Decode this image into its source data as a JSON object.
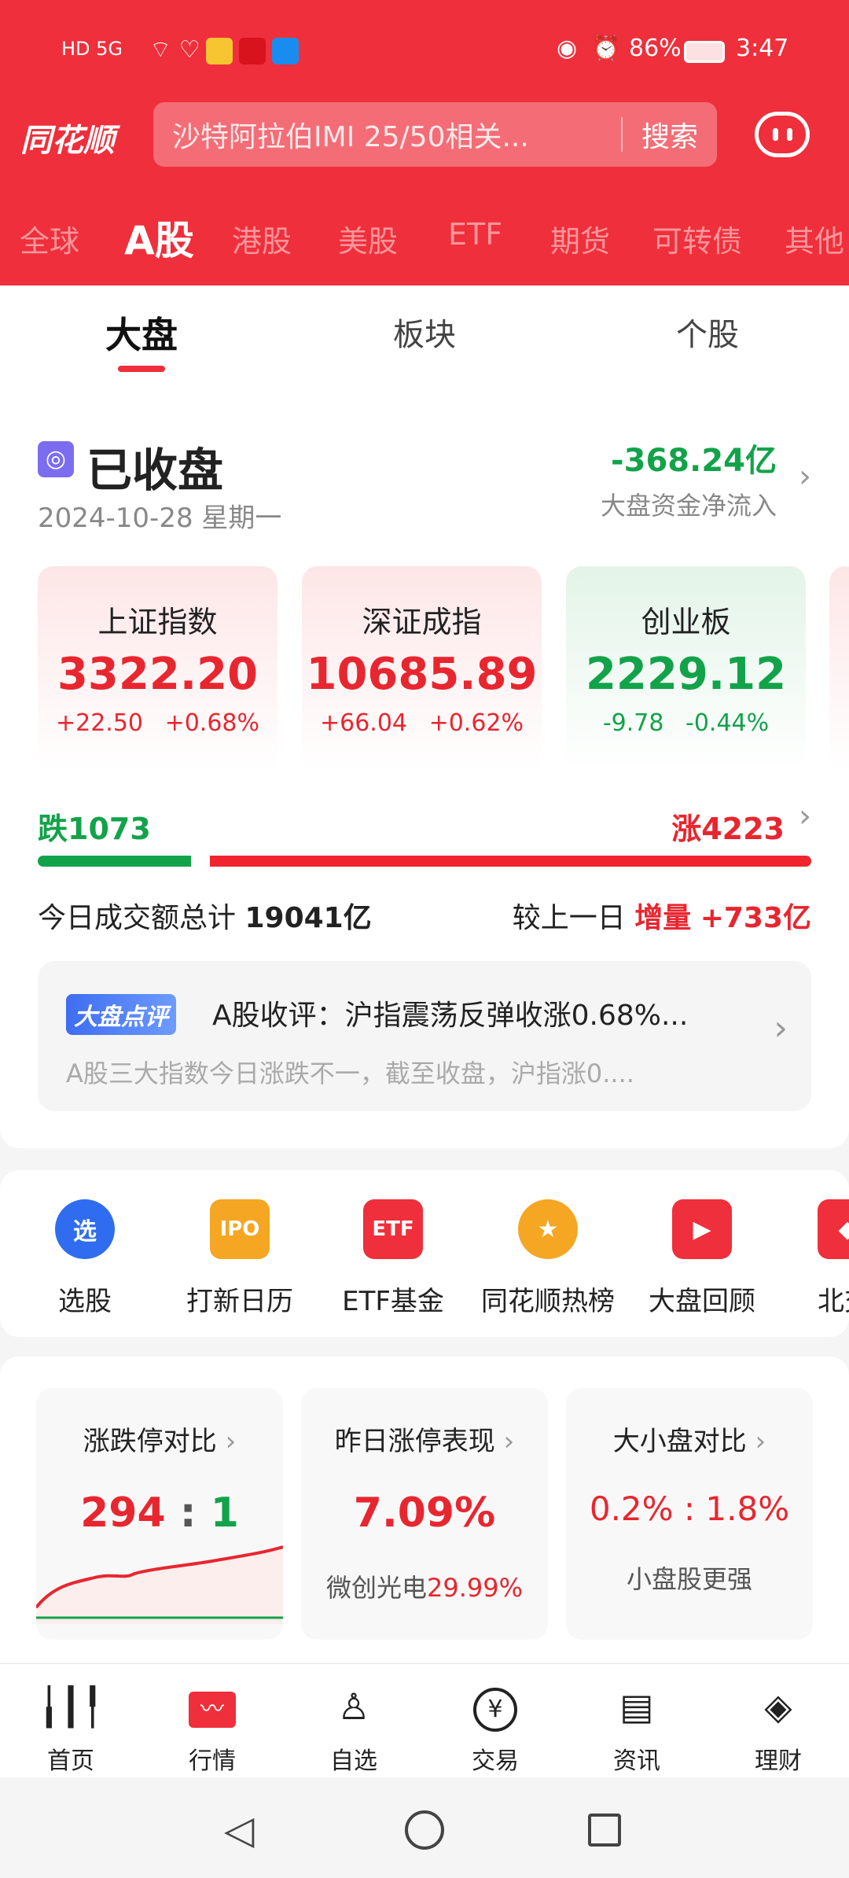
{
  "status_bar": {
    "left": "HD 5G",
    "battery": "86%",
    "time": "3:47"
  },
  "header": {
    "logo": "同花顺",
    "search_placeholder": "沙特阿拉伯IMI 25/50相关...",
    "search_button": "搜索",
    "market_tabs": [
      "全球",
      "A股",
      "港股",
      "美股",
      "ETF",
      "期货",
      "可转债",
      "其他"
    ],
    "active_market_tab": "A股"
  },
  "sub_tabs": [
    "大盘",
    "板块",
    "个股"
  ],
  "active_sub_tab": "大盘",
  "market": {
    "status": "已收盘",
    "date": "2024-10-28 星期一",
    "net_inflow": "-368.24亿",
    "net_inflow_label": "大盘资金净流入"
  },
  "indices": [
    {
      "name": "上证指数",
      "value": "3322.20",
      "change": "+22.50",
      "pct": "+0.68%",
      "trend": "up"
    },
    {
      "name": "深证成指",
      "value": "10685.89",
      "change": "+66.04",
      "pct": "+0.62%",
      "trend": "up"
    },
    {
      "name": "创业板",
      "value": "2229.12",
      "change": "-9.78",
      "pct": "-0.44%",
      "trend": "down"
    }
  ],
  "breadth": {
    "fall": "跌1073",
    "rise": "涨4223",
    "fall_count": 1073,
    "rise_count": 4223
  },
  "turnover": {
    "label": "今日成交额总计",
    "value": "19041亿",
    "compare_label": "较上一日",
    "delta_label": "增量",
    "delta": "+733亿"
  },
  "commentary": {
    "badge": "大盘点评",
    "title": "A股收评：沪指震荡反弹收涨0.68%...",
    "summary": "A股三大指数今日涨跌不一，截至收盘，沪指涨0...."
  },
  "shortcuts": [
    {
      "label": "选股",
      "icon": "选",
      "color": "#2f6cf0"
    },
    {
      "label": "打新日历",
      "icon": "IPO",
      "color": "#f5a623"
    },
    {
      "label": "ETF基金",
      "icon": "ETF",
      "color": "#ef2f3b"
    },
    {
      "label": "同花顺热榜",
      "icon": "★",
      "color": "#f5a623"
    },
    {
      "label": "大盘回顾",
      "icon": "▶",
      "color": "#ef2f3b"
    },
    {
      "label": "北交",
      "icon": "◆",
      "color": "#ef2f3b"
    }
  ],
  "stats": [
    {
      "title": "涨跌停对比",
      "limit_up": "294",
      "sep": ":",
      "limit_down": "1"
    },
    {
      "title": "昨日涨停表现",
      "value": "7.09%",
      "sub_name": "微创光电",
      "sub_value": "29.99%"
    },
    {
      "title": "大小盘对比",
      "value": "0.2% : 1.8%",
      "sub": "小盘股更强"
    }
  ],
  "bottom_nav": [
    {
      "label": "首页",
      "icon": "candlestick-icon"
    },
    {
      "label": "行情",
      "icon": "chart-icon"
    },
    {
      "label": "自选",
      "icon": "user-icon"
    },
    {
      "label": "交易",
      "icon": "yen-icon"
    },
    {
      "label": "资讯",
      "icon": "news-icon"
    },
    {
      "label": "理财",
      "icon": "moneybag-icon"
    }
  ],
  "active_nav": "行情",
  "colors": {
    "brand": "#ef2f3b",
    "up": "#e8262f",
    "down": "#12a34a"
  }
}
